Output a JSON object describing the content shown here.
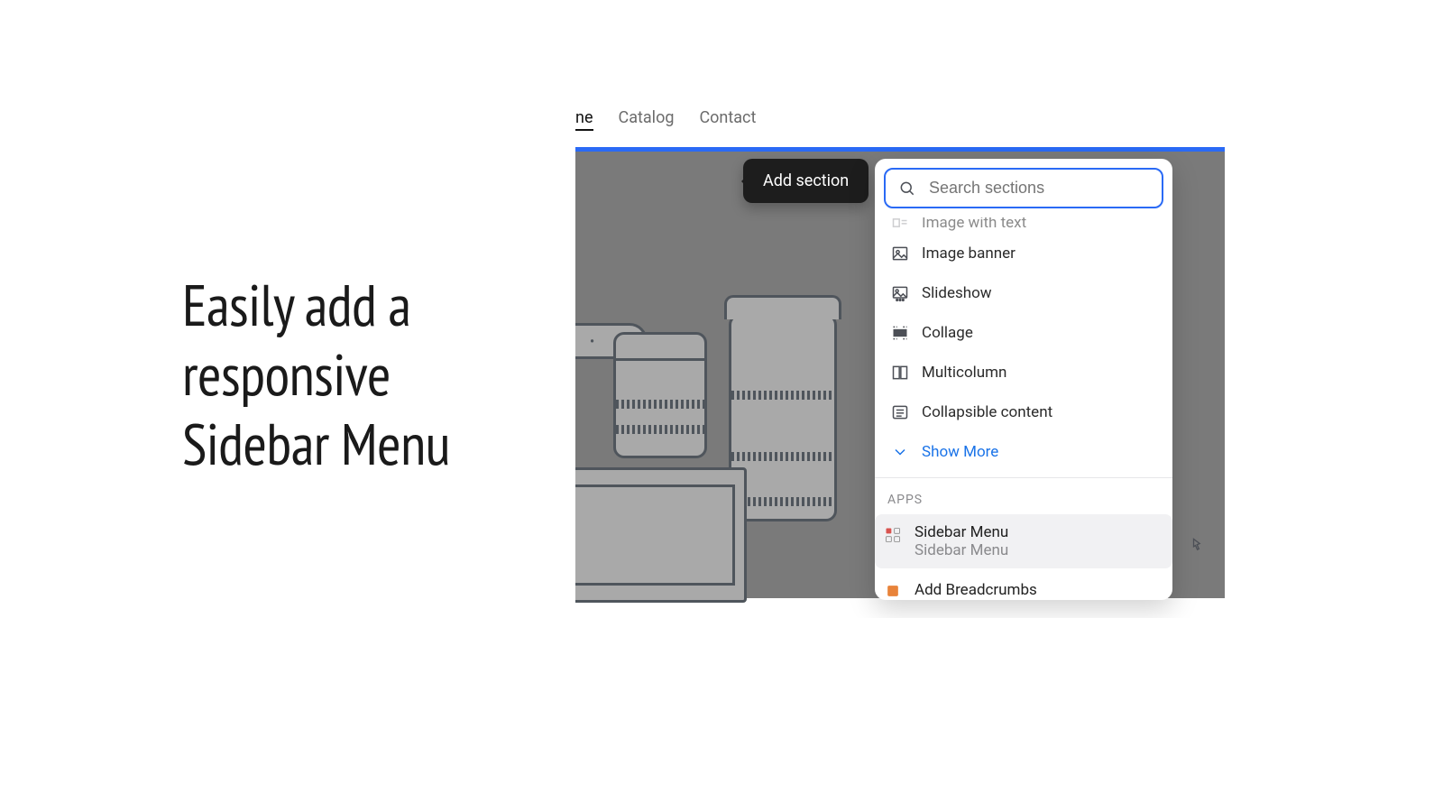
{
  "headline": "Easily add a responsive Sidebar Menu",
  "nav": {
    "items": [
      "ne",
      "Catalog",
      "Contact"
    ],
    "active_index": 0
  },
  "add_section_label": "Add section",
  "search": {
    "placeholder": "Search sections",
    "value": ""
  },
  "sections": {
    "cutoff_item": {
      "label": "Image with text"
    },
    "items": [
      {
        "label": "Image banner"
      },
      {
        "label": "Slideshow"
      },
      {
        "label": "Collage"
      },
      {
        "label": "Multicolumn"
      },
      {
        "label": "Collapsible content"
      }
    ],
    "show_more": "Show More"
  },
  "apps": {
    "heading": "APPS",
    "items": [
      {
        "title": "Sidebar Menu",
        "subtitle": "Sidebar Menu",
        "hover": true
      },
      {
        "title": "Add Breadcrumbs"
      }
    ]
  }
}
